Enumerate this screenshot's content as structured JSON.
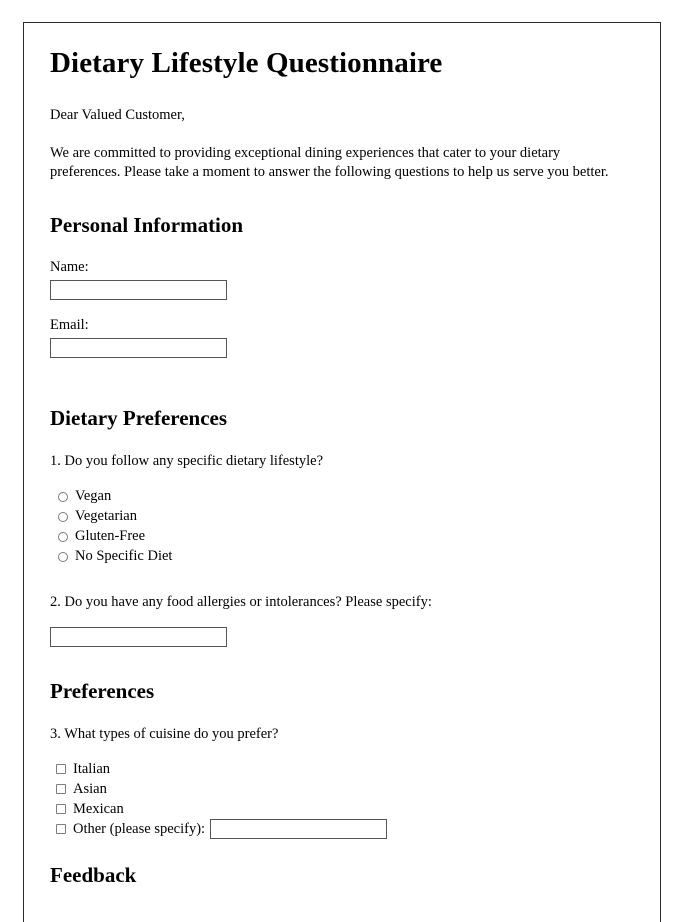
{
  "document": {
    "title": "Dietary Lifestyle Questionnaire",
    "salutation": "Dear Valued Customer,",
    "intro_paragraph": "We are committed to providing exceptional dining experiences that cater to your dietary preferences. Please take a moment to answer the following questions to help us serve you better."
  },
  "personal_information": {
    "heading": "Personal Information",
    "name_label": "Name:",
    "name_value": "",
    "name_placeholder": "",
    "email_label": "Email:",
    "email_value": "",
    "email_placeholder": ""
  },
  "dietary_preferences": {
    "heading": "Dietary Preferences",
    "question1": "1. Do you follow any specific dietary lifestyle?",
    "options": [
      {
        "label": "Vegan",
        "selected": false
      },
      {
        "label": "Vegetarian",
        "selected": false
      },
      {
        "label": "Gluten-Free",
        "selected": false
      },
      {
        "label": "No Specific Diet",
        "selected": false
      }
    ],
    "question2": "2. Do you have any food allergies or intolerances? Please specify:",
    "allergies_value": "",
    "allergies_placeholder": ""
  },
  "preferences": {
    "heading": "Preferences",
    "question3": "3. What types of cuisine do you prefer?",
    "options": [
      {
        "label": "Italian",
        "checked": false
      },
      {
        "label": "Asian",
        "checked": false
      },
      {
        "label": "Mexican",
        "checked": false
      }
    ],
    "other_label": "Other (please specify):",
    "other_checked": false,
    "other_value": "",
    "other_placeholder": ""
  },
  "feedback": {
    "heading": "Feedback"
  },
  "colors": {
    "page_border": "#2b2b2b",
    "input_border": "#555555",
    "control_border": "#7d7d7d",
    "text": "#000000",
    "background": "#ffffff"
  }
}
